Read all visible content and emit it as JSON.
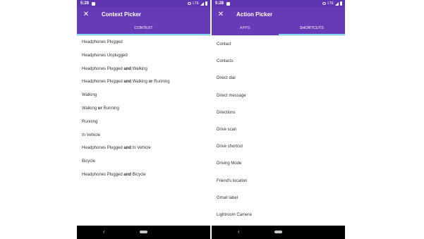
{
  "status": {
    "time": "5:28",
    "network": "LTE"
  },
  "left": {
    "title": "Context Picker",
    "tabs": [
      {
        "label": "CONTEXT",
        "active": true
      }
    ],
    "items": [
      {
        "parts": [
          {
            "t": "Headphones Plugged",
            "b": false
          }
        ]
      },
      {
        "parts": [
          {
            "t": "Headphones Unplugged",
            "b": false
          }
        ]
      },
      {
        "parts": [
          {
            "t": "Headphones Plugged ",
            "b": false
          },
          {
            "t": "and",
            "b": true
          },
          {
            "t": " Walking",
            "b": false
          }
        ]
      },
      {
        "parts": [
          {
            "t": "Headphones Plugged ",
            "b": false
          },
          {
            "t": "and",
            "b": true
          },
          {
            "t": " Walking ",
            "b": false
          },
          {
            "t": "or",
            "b": true
          },
          {
            "t": " Running",
            "b": false
          }
        ]
      },
      {
        "parts": [
          {
            "t": "Walking",
            "b": false
          }
        ]
      },
      {
        "parts": [
          {
            "t": "Walking ",
            "b": false
          },
          {
            "t": "or",
            "b": true
          },
          {
            "t": " Running",
            "b": false
          }
        ]
      },
      {
        "parts": [
          {
            "t": "Running",
            "b": false
          }
        ]
      },
      {
        "parts": [
          {
            "t": "In Vehicle",
            "b": false
          }
        ]
      },
      {
        "parts": [
          {
            "t": "Headphones Plugged ",
            "b": false
          },
          {
            "t": "and",
            "b": true
          },
          {
            "t": " In Vehicle",
            "b": false
          }
        ]
      },
      {
        "parts": [
          {
            "t": "Bicycle",
            "b": false
          }
        ]
      },
      {
        "parts": [
          {
            "t": "Headphones Plugged ",
            "b": false
          },
          {
            "t": "and",
            "b": true
          },
          {
            "t": " Bicycle",
            "b": false
          }
        ]
      }
    ]
  },
  "right": {
    "title": "Action Picker",
    "tabs": [
      {
        "label": "APPS",
        "active": false
      },
      {
        "label": "SHORTCUTS",
        "active": true
      }
    ],
    "items": [
      "Contact",
      "Contacts",
      "Direct dial",
      "Direct message",
      "Directions",
      "Drive scan",
      "Drive shortcut",
      "Driving Mode",
      "Friend's location",
      "Gmail label",
      "Lightroom Camera"
    ]
  },
  "colors": {
    "statusbar": "#5d35b0",
    "appbar": "#673ab7",
    "tab_indicator": "#80d8ff",
    "navbar": "#000000"
  },
  "icons": {
    "close": "close-icon",
    "back": "back-arrow-icon",
    "home": "home-pill-icon"
  }
}
